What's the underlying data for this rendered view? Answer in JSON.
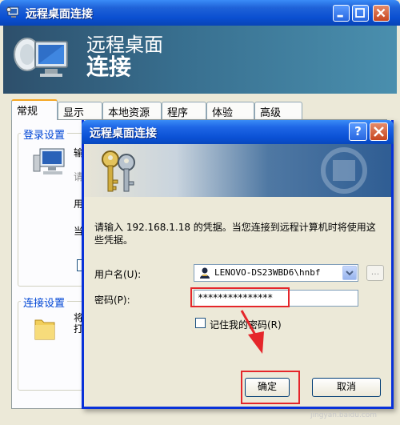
{
  "outer_window": {
    "title": "远程桌面连接",
    "banner_title_line1": "远程桌面",
    "banner_title_line2": "连接"
  },
  "tabs": [
    {
      "label": "常规",
      "active": true
    },
    {
      "label": "显示",
      "active": false
    },
    {
      "label": "本地资源",
      "active": false
    },
    {
      "label": "程序",
      "active": false
    },
    {
      "label": "体验",
      "active": false
    },
    {
      "label": "高级",
      "active": false
    }
  ],
  "general_tab": {
    "login_settings_title": "登录设置",
    "connection_settings_title": "连接设置",
    "partial_labels": [
      "输",
      "请",
      "用",
      "当",
      "将",
      "打"
    ]
  },
  "dialog": {
    "title": "远程桌面连接",
    "help_label": "?",
    "message": "请输入 192.168.1.18 的凭据。当您连接到远程计算机时将使用这些凭据。",
    "username_label": "用户名(U):",
    "username_value": "LENOVO-DS23WBD6\\hnbf",
    "browse_label": "...",
    "password_label": "密码(P):",
    "password_value": "***************",
    "remember_label": "记住我的密码(R)",
    "remember_checked": false,
    "ok_label": "确定",
    "cancel_label": "取消"
  },
  "watermark": {
    "site_text": "jingyan.baidu.com"
  },
  "colors": {
    "titlebar_blue": "#0a4fd1",
    "highlight_red": "#e5262a",
    "group_title_blue": "#0046d5",
    "tab_active_orange": "#f5a623"
  }
}
